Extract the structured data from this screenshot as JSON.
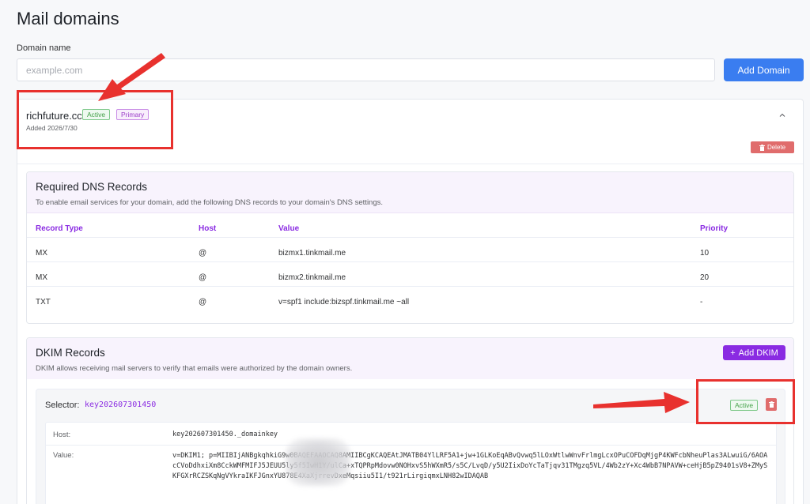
{
  "page": {
    "title": "Mail domains"
  },
  "add_form": {
    "label": "Domain name",
    "placeholder": "example.com",
    "value": "",
    "button_label": "Add Domain"
  },
  "domain": {
    "name": "richfuture.cc",
    "status_badge": "Active",
    "primary_badge": "Primary",
    "added": "Added 2026/7/30",
    "delete_label": "Delete"
  },
  "dns": {
    "title": "Required DNS Records",
    "description": "To enable email services for your domain, add the following DNS records to your domain's DNS settings.",
    "columns": [
      "Record Type",
      "Host",
      "Value",
      "Priority"
    ],
    "rows": [
      [
        "MX",
        "@",
        "bizmx1.tinkmail.me",
        "10"
      ],
      [
        "MX",
        "@",
        "bizmx2.tinkmail.me",
        "20"
      ],
      [
        "TXT",
        "@",
        "v=spf1 include:bizspf.tinkmail.me ~all",
        "-"
      ]
    ]
  },
  "dkim": {
    "title": "DKIM Records",
    "description": "DKIM allows receiving mail servers to verify that emails were authorized by the domain owners.",
    "add_label": "Add DKIM",
    "selector_label": "Selector:",
    "selector": "key202607301450",
    "status_badge": "Active",
    "host_label": "Host:",
    "host_value": "key202607301450._domainkey",
    "value_label": "Value:",
    "value": "v=DKIM1; p=MIIBIjANBgkqhkiG9w0BAQEFAAOCAQ8AMIIBCgKCAQEAtJMATB04YlLRF5A1+jw+1GLKoEqABvQvwq5lLOxWtlwWnvFrlmgLcxOPuCOFDqMjgP4KWFcbNheuPlas3ALwuiG/6AOAcCVoDdhxiXm8CckWMFMIFJ5JEUU5ly5f5IwH1Y/ulCa+xTQPRpMdovw0NOHxvS5hWXmR5/s5C/LvqD/y5U2IixDoYcTaTjqv31TMgzq5VL/4Wb2zY+Xc4WbB7NPAVW+ceHjB5pZ9401sV8+ZMySKFGXrRCZSKqNgVYkraIKFJGnxYU878E4XaXjrrevDxeMqsiiu5I1/t921rLirgiqmxLNH82wIDAQAB"
  },
  "colors": {
    "accent_blue": "#3a7df0",
    "accent_purple": "#8a2be2",
    "danger": "#e06c6c",
    "success": "#43a047",
    "annotation": "#e8312e"
  }
}
